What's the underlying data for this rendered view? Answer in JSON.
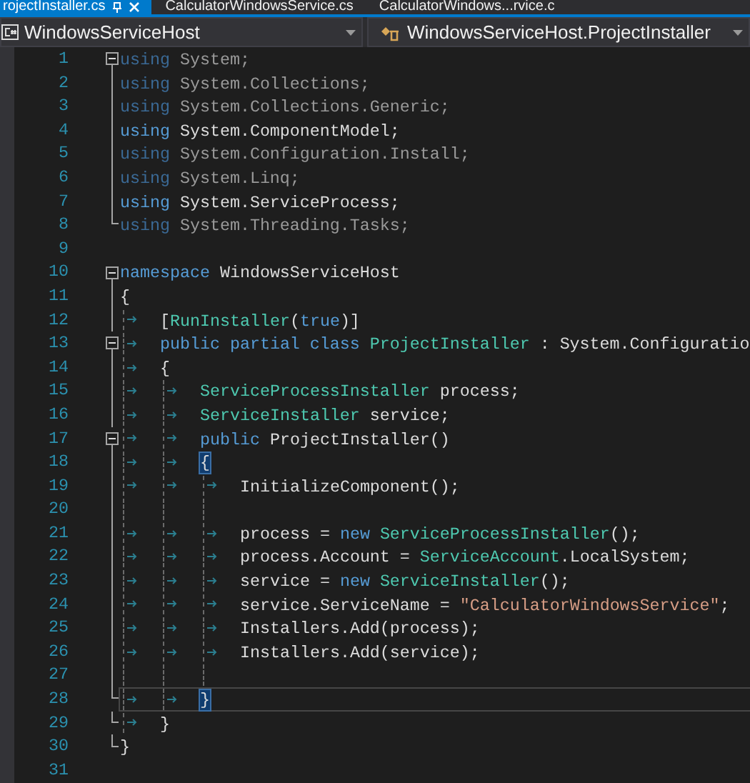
{
  "tabs": [
    {
      "label": "rojectInstaller.cs",
      "selected": true
    },
    {
      "label": "CalculatorWindowsService.cs",
      "selected": false
    },
    {
      "label": "CalculatorWindows...rvice.c",
      "selected": false
    }
  ],
  "navbar": {
    "project": "WindowsServiceHost",
    "member": "WindowsServiceHost.ProjectInstaller"
  },
  "lines": [
    {
      "number": "1",
      "outlined": true,
      "collapsible": true,
      "block_end": false,
      "faded": true,
      "tokens": [
        {
          "kind": "kw",
          "text": "using"
        },
        {
          "kind": "plain",
          "text": " System;"
        }
      ]
    },
    {
      "number": "2",
      "outlined": true,
      "collapsible": false,
      "block_end": false,
      "faded": true,
      "tokens": [
        {
          "kind": "kw",
          "text": "using"
        },
        {
          "kind": "plain",
          "text": " System.Collections;"
        }
      ]
    },
    {
      "number": "3",
      "outlined": true,
      "collapsible": false,
      "block_end": false,
      "faded": true,
      "tokens": [
        {
          "kind": "kw",
          "text": "using"
        },
        {
          "kind": "plain",
          "text": " System.Collections.Generic;"
        }
      ]
    },
    {
      "number": "4",
      "outlined": true,
      "collapsible": false,
      "block_end": false,
      "faded": false,
      "tokens": [
        {
          "kind": "kw",
          "text": "using"
        },
        {
          "kind": "plain",
          "text": " System.ComponentModel;"
        }
      ]
    },
    {
      "number": "5",
      "outlined": true,
      "collapsible": false,
      "block_end": false,
      "faded": true,
      "tokens": [
        {
          "kind": "kw",
          "text": "using"
        },
        {
          "kind": "plain",
          "text": " System.Configuration.Install;"
        }
      ]
    },
    {
      "number": "6",
      "outlined": true,
      "collapsible": false,
      "block_end": false,
      "faded": true,
      "tokens": [
        {
          "kind": "kw",
          "text": "using"
        },
        {
          "kind": "plain",
          "text": " System.Linq;"
        }
      ]
    },
    {
      "number": "7",
      "outlined": true,
      "collapsible": false,
      "block_end": false,
      "faded": false,
      "tokens": [
        {
          "kind": "kw",
          "text": "using"
        },
        {
          "kind": "plain",
          "text": " System.ServiceProcess;"
        }
      ]
    },
    {
      "number": "8",
      "outlined": true,
      "collapsible": false,
      "block_end": true,
      "faded": true,
      "tokens": [
        {
          "kind": "kw",
          "text": "using"
        },
        {
          "kind": "plain",
          "text": " System.Threading.Tasks;"
        }
      ]
    },
    {
      "number": "9",
      "outlined": false,
      "collapsible": false,
      "block_end": false
    },
    {
      "number": "10",
      "outlined": true,
      "collapsible": true,
      "block_end": false,
      "tokens": [
        {
          "kind": "kw",
          "text": "namespace"
        },
        {
          "kind": "plain",
          "text": " WindowsServiceHost"
        }
      ]
    },
    {
      "number": "11",
      "outlined": true,
      "collapsible": false,
      "block_end": false,
      "tokens": [
        {
          "kind": "plain",
          "text": "{"
        }
      ]
    },
    {
      "number": "12",
      "outlined": true,
      "collapsible": false,
      "block_end": false,
      "tokens": [
        {
          "kind": "tab"
        },
        {
          "kind": "plain",
          "text": "["
        },
        {
          "kind": "type",
          "text": "RunInstaller"
        },
        {
          "kind": "plain",
          "text": "("
        },
        {
          "kind": "kw",
          "text": "true"
        },
        {
          "kind": "plain",
          "text": ")]"
        }
      ]
    },
    {
      "number": "13",
      "outlined": true,
      "collapsible": true,
      "block_end": false,
      "tokens": [
        {
          "kind": "tab"
        },
        {
          "kind": "kw",
          "text": "public partial class "
        },
        {
          "kind": "type",
          "text": "ProjectInstaller"
        },
        {
          "kind": "plain",
          "text": " : System.Configuratio"
        }
      ]
    },
    {
      "number": "14",
      "outlined": true,
      "collapsible": false,
      "block_end": false,
      "tokens": [
        {
          "kind": "tab"
        },
        {
          "kind": "plain",
          "text": "{"
        }
      ]
    },
    {
      "number": "15",
      "outlined": true,
      "collapsible": false,
      "block_end": false,
      "tokens": [
        {
          "kind": "tab"
        },
        {
          "kind": "tab"
        },
        {
          "kind": "type",
          "text": "ServiceProcessInstaller"
        },
        {
          "kind": "plain",
          "text": " process;"
        }
      ]
    },
    {
      "number": "16",
      "outlined": true,
      "collapsible": false,
      "block_end": false,
      "tokens": [
        {
          "kind": "tab"
        },
        {
          "kind": "tab"
        },
        {
          "kind": "type",
          "text": "ServiceInstaller"
        },
        {
          "kind": "plain",
          "text": " service;"
        }
      ]
    },
    {
      "number": "17",
      "outlined": true,
      "collapsible": true,
      "block_end": false,
      "tokens": [
        {
          "kind": "tab"
        },
        {
          "kind": "tab"
        },
        {
          "kind": "kw",
          "text": "public"
        },
        {
          "kind": "plain",
          "text": " ProjectInstaller()"
        }
      ]
    },
    {
      "number": "18",
      "outlined": true,
      "collapsible": false,
      "block_end": false,
      "tokens": [
        {
          "kind": "tab"
        },
        {
          "kind": "tab"
        },
        {
          "kind": "match",
          "text": "{"
        }
      ]
    },
    {
      "number": "19",
      "outlined": true,
      "collapsible": false,
      "block_end": false,
      "tokens": [
        {
          "kind": "tab"
        },
        {
          "kind": "tab"
        },
        {
          "kind": "tab"
        },
        {
          "kind": "plain",
          "text": "InitializeComponent();"
        }
      ]
    },
    {
      "number": "20",
      "outlined": true,
      "collapsible": false,
      "block_end": false,
      "tokens": [
        {
          "kind": "guide"
        },
        {
          "kind": "guide"
        },
        {
          "kind": "guide"
        }
      ]
    },
    {
      "number": "21",
      "outlined": true,
      "collapsible": false,
      "block_end": false,
      "tokens": [
        {
          "kind": "tab"
        },
        {
          "kind": "tab"
        },
        {
          "kind": "tab"
        },
        {
          "kind": "plain",
          "text": "process = "
        },
        {
          "kind": "kw",
          "text": "new "
        },
        {
          "kind": "type",
          "text": "ServiceProcessInstaller"
        },
        {
          "kind": "plain",
          "text": "();"
        }
      ]
    },
    {
      "number": "22",
      "outlined": true,
      "collapsible": false,
      "block_end": false,
      "tokens": [
        {
          "kind": "tab"
        },
        {
          "kind": "tab"
        },
        {
          "kind": "tab"
        },
        {
          "kind": "plain",
          "text": "process.Account = "
        },
        {
          "kind": "type",
          "text": "ServiceAccount"
        },
        {
          "kind": "plain",
          "text": ".LocalSystem;"
        }
      ]
    },
    {
      "number": "23",
      "outlined": true,
      "collapsible": false,
      "block_end": false,
      "tokens": [
        {
          "kind": "tab"
        },
        {
          "kind": "tab"
        },
        {
          "kind": "tab"
        },
        {
          "kind": "plain",
          "text": "service = "
        },
        {
          "kind": "kw",
          "text": "new "
        },
        {
          "kind": "type",
          "text": "ServiceInstaller"
        },
        {
          "kind": "plain",
          "text": "();"
        }
      ]
    },
    {
      "number": "24",
      "outlined": true,
      "collapsible": false,
      "block_end": false,
      "tokens": [
        {
          "kind": "tab"
        },
        {
          "kind": "tab"
        },
        {
          "kind": "tab"
        },
        {
          "kind": "plain",
          "text": "service.ServiceName = "
        },
        {
          "kind": "str",
          "text": "\"CalculatorWindowsService\""
        },
        {
          "kind": "plain",
          "text": ";"
        }
      ]
    },
    {
      "number": "25",
      "outlined": true,
      "collapsible": false,
      "block_end": false,
      "tokens": [
        {
          "kind": "tab"
        },
        {
          "kind": "tab"
        },
        {
          "kind": "tab"
        },
        {
          "kind": "plain",
          "text": "Installers.Add(process);"
        }
      ]
    },
    {
      "number": "26",
      "outlined": true,
      "collapsible": false,
      "block_end": false,
      "tokens": [
        {
          "kind": "tab"
        },
        {
          "kind": "tab"
        },
        {
          "kind": "tab"
        },
        {
          "kind": "plain",
          "text": "Installers.Add(service);"
        }
      ]
    },
    {
      "number": "27",
      "outlined": true,
      "collapsible": false,
      "block_end": false,
      "tokens": [
        {
          "kind": "guide"
        },
        {
          "kind": "guide"
        },
        {
          "kind": "guide"
        }
      ]
    },
    {
      "number": "28",
      "outlined": true,
      "collapsible": false,
      "block_end": true,
      "current": true,
      "tokens": [
        {
          "kind": "tab"
        },
        {
          "kind": "tab"
        },
        {
          "kind": "match",
          "text": "}"
        }
      ]
    },
    {
      "number": "29",
      "outlined": true,
      "collapsible": false,
      "block_end": true,
      "tokens": [
        {
          "kind": "tab"
        },
        {
          "kind": "plain",
          "text": "}"
        }
      ]
    },
    {
      "number": "30",
      "outlined": true,
      "collapsible": false,
      "block_end": true,
      "tokens": [
        {
          "kind": "plain",
          "text": "}"
        }
      ]
    },
    {
      "number": "31",
      "outlined": false,
      "collapsible": false,
      "block_end": false
    }
  ]
}
